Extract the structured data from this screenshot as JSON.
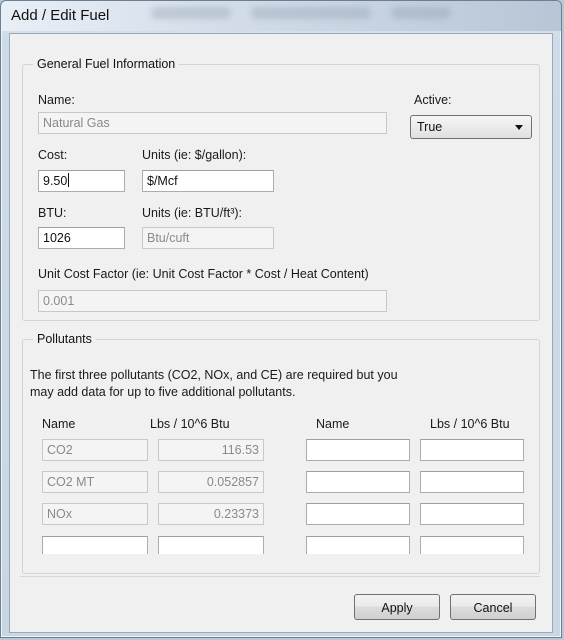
{
  "window": {
    "title": "Add / Edit Fuel"
  },
  "general": {
    "legend": "General Fuel Information",
    "name_label": "Name:",
    "name_value": "Natural Gas",
    "active_label": "Active:",
    "active_value": "True",
    "cost_label": "Cost:",
    "cost_value": "9.50",
    "cost_units_label": "Units (ie: $/gallon):",
    "cost_units_value": "$/Mcf",
    "btu_label": "BTU:",
    "btu_value": "1026",
    "btu_units_label": "Units (ie: BTU/ft³):",
    "btu_units_value": "Btu/cuft",
    "factor_label": "Unit Cost Factor (ie: Unit Cost Factor * Cost / Heat Content)",
    "factor_value": "0.001"
  },
  "pollutants": {
    "legend": "Pollutants",
    "description_line1": "The first three pollutants (CO2, NOx, and CE) are required but you",
    "description_line2": "may add data for up to five additional pollutants.",
    "headers": [
      "Name",
      "Lbs / 10^6 Btu",
      "Name",
      "Lbs / 10^6 Btu"
    ],
    "rows": [
      [
        "CO2",
        "116.53",
        "",
        ""
      ],
      [
        "CO2 MT",
        "0.052857",
        "",
        ""
      ],
      [
        "NOx",
        "0.23373",
        "",
        ""
      ],
      [
        "",
        "",
        "",
        ""
      ]
    ]
  },
  "buttons": {
    "apply": "Apply",
    "cancel": "Cancel"
  }
}
